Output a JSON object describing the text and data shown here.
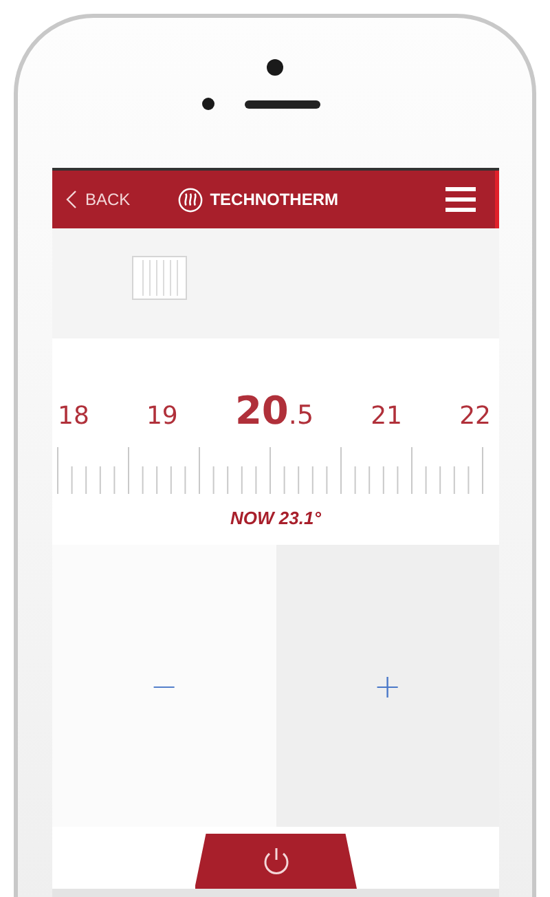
{
  "header": {
    "back_label": "BACK",
    "brand": "TECHNOTHERM"
  },
  "scale": {
    "labels": [
      {
        "text": "18",
        "selected": false
      },
      {
        "text": "19",
        "selected": false
      },
      {
        "text": "**20**.5",
        "selected": true
      },
      {
        "text": "21",
        "selected": false
      },
      {
        "text": "22",
        "selected": false
      }
    ]
  },
  "current": "NOW 23.1°",
  "controls": {
    "decrease": "−",
    "increase": "+"
  }
}
